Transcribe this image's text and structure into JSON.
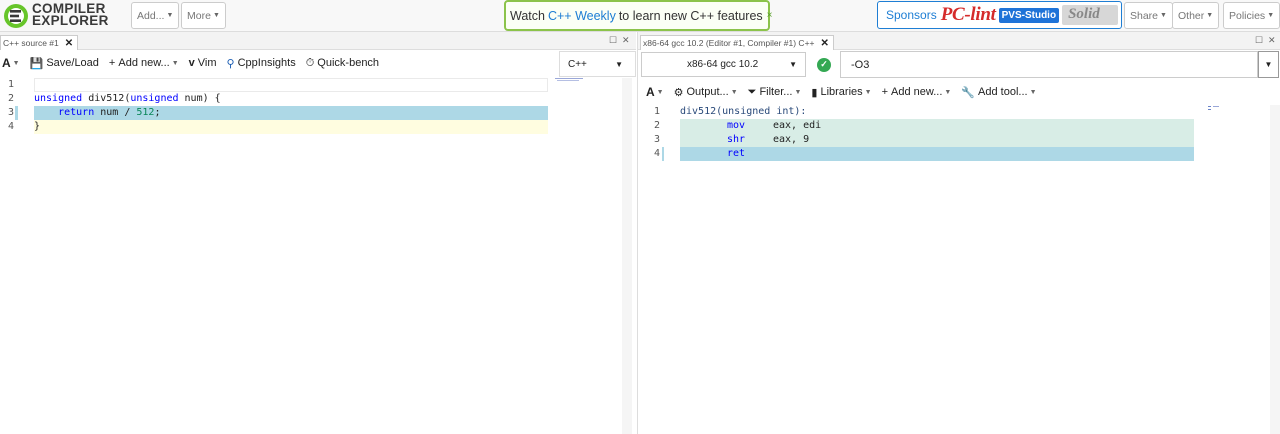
{
  "navbar": {
    "logo_line1": "COMPILER",
    "logo_line2": "EXPLORER",
    "add_label": "Add...",
    "more_label": "More",
    "notice_prefix": "Watch",
    "notice_link": "C++ Weekly",
    "notice_suffix": "to learn new C++ features",
    "notice_close": "×",
    "sponsors_label": "Sponsors",
    "sponsor_pclint": "PC-lint",
    "sponsor_pvs": "PVS-Studio",
    "sponsor_solid": "Solid",
    "share_label": "Share",
    "other_label": "Other",
    "policies_label": "Policies"
  },
  "editor_pane": {
    "tab_title": "C++ source #1",
    "tab_close": "✕",
    "toolbar": {
      "font": "A",
      "save_load": "Save/Load",
      "add_new": "Add new...",
      "vim": "Vim",
      "cppinsights": "CppInsights",
      "quick_bench": "Quick-bench"
    },
    "language": "C++",
    "lines": [
      {
        "n": "1"
      },
      {
        "n": "2"
      },
      {
        "n": "3"
      },
      {
        "n": "4"
      }
    ],
    "code": {
      "l2_kw": "unsigned",
      "l2_fn": " div512(",
      "l2_kw2": "unsigned",
      "l2_rest": " num) {",
      "l3_kw": "return",
      "l3_mid": " num / ",
      "l3_num": "512",
      "l3_end": ";",
      "l4": "}"
    }
  },
  "compiler_pane": {
    "tab_title": "x86-64 gcc 10.2 (Editor #1, Compiler #1) C++",
    "tab_close": "✕",
    "compiler": "x86-64 gcc 10.2",
    "options": "-O3",
    "toolbar": {
      "font": "A",
      "output": "Output...",
      "filter": "Filter...",
      "libraries": "Libraries",
      "add_new": "Add new...",
      "add_tool": "Add tool..."
    },
    "asm_lines": [
      {
        "n": "1",
        "text": "div512(unsigned int):"
      },
      {
        "n": "2",
        "op": "mov",
        "args": "eax, edi"
      },
      {
        "n": "3",
        "op": "shr",
        "args": "eax, 9"
      },
      {
        "n": "4",
        "op": "ret",
        "args": ""
      }
    ]
  },
  "colors": {
    "accent": "#1e7ed4",
    "notice_border": "#8bc34a",
    "highlight_blue": "#add8e6",
    "highlight_green": "#d8ede6",
    "highlight_yellow": "#fffde0"
  }
}
